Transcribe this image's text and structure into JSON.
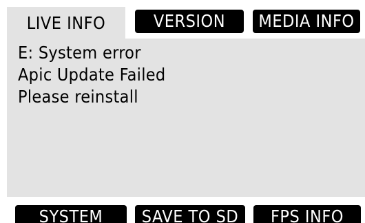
{
  "tabs": {
    "live_info": "LIVE INFO",
    "version": "VERSION",
    "media_info": "MEDIA INFO"
  },
  "messages": {
    "line1": "E: System error",
    "line2": "Apic Update Failed",
    "line3": "Please reinstall"
  },
  "buttons": {
    "system": "SYSTEM",
    "save_to_sd": "SAVE TO SD",
    "fps_info": "FPS INFO"
  },
  "colors": {
    "panel_background": "#e3e3e3",
    "button_background": "#000000",
    "button_text": "#ffffff"
  }
}
